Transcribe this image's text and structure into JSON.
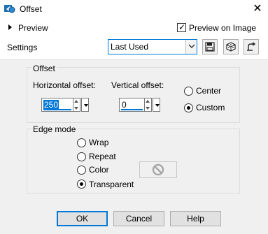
{
  "window": {
    "title": "Offset"
  },
  "preview": {
    "label": "Preview",
    "checkbox_label": "Preview on Image",
    "checked": true
  },
  "settings": {
    "label": "Settings",
    "selected": "Last Used"
  },
  "offset_group": {
    "title": "Offset",
    "horizontal_label": "Horizontal offset:",
    "horizontal_value": "250",
    "vertical_label": "Vertical offset:",
    "vertical_value": "0",
    "center_label": "Center",
    "custom_label": "Custom",
    "selected": "Custom"
  },
  "edge_group": {
    "title": "Edge mode",
    "options": [
      "Wrap",
      "Repeat",
      "Color",
      "Transparent"
    ],
    "selected": "Transparent"
  },
  "buttons": {
    "ok": "OK",
    "cancel": "Cancel",
    "help": "Help"
  },
  "colors": {
    "accent": "#0078d7",
    "panel_bg": "#f0f0f0"
  },
  "icons": [
    "app-icon",
    "close-icon",
    "expand-triangle-icon",
    "save-preset-icon",
    "randomize-icon",
    "reset-icon",
    "no-color-icon"
  ]
}
